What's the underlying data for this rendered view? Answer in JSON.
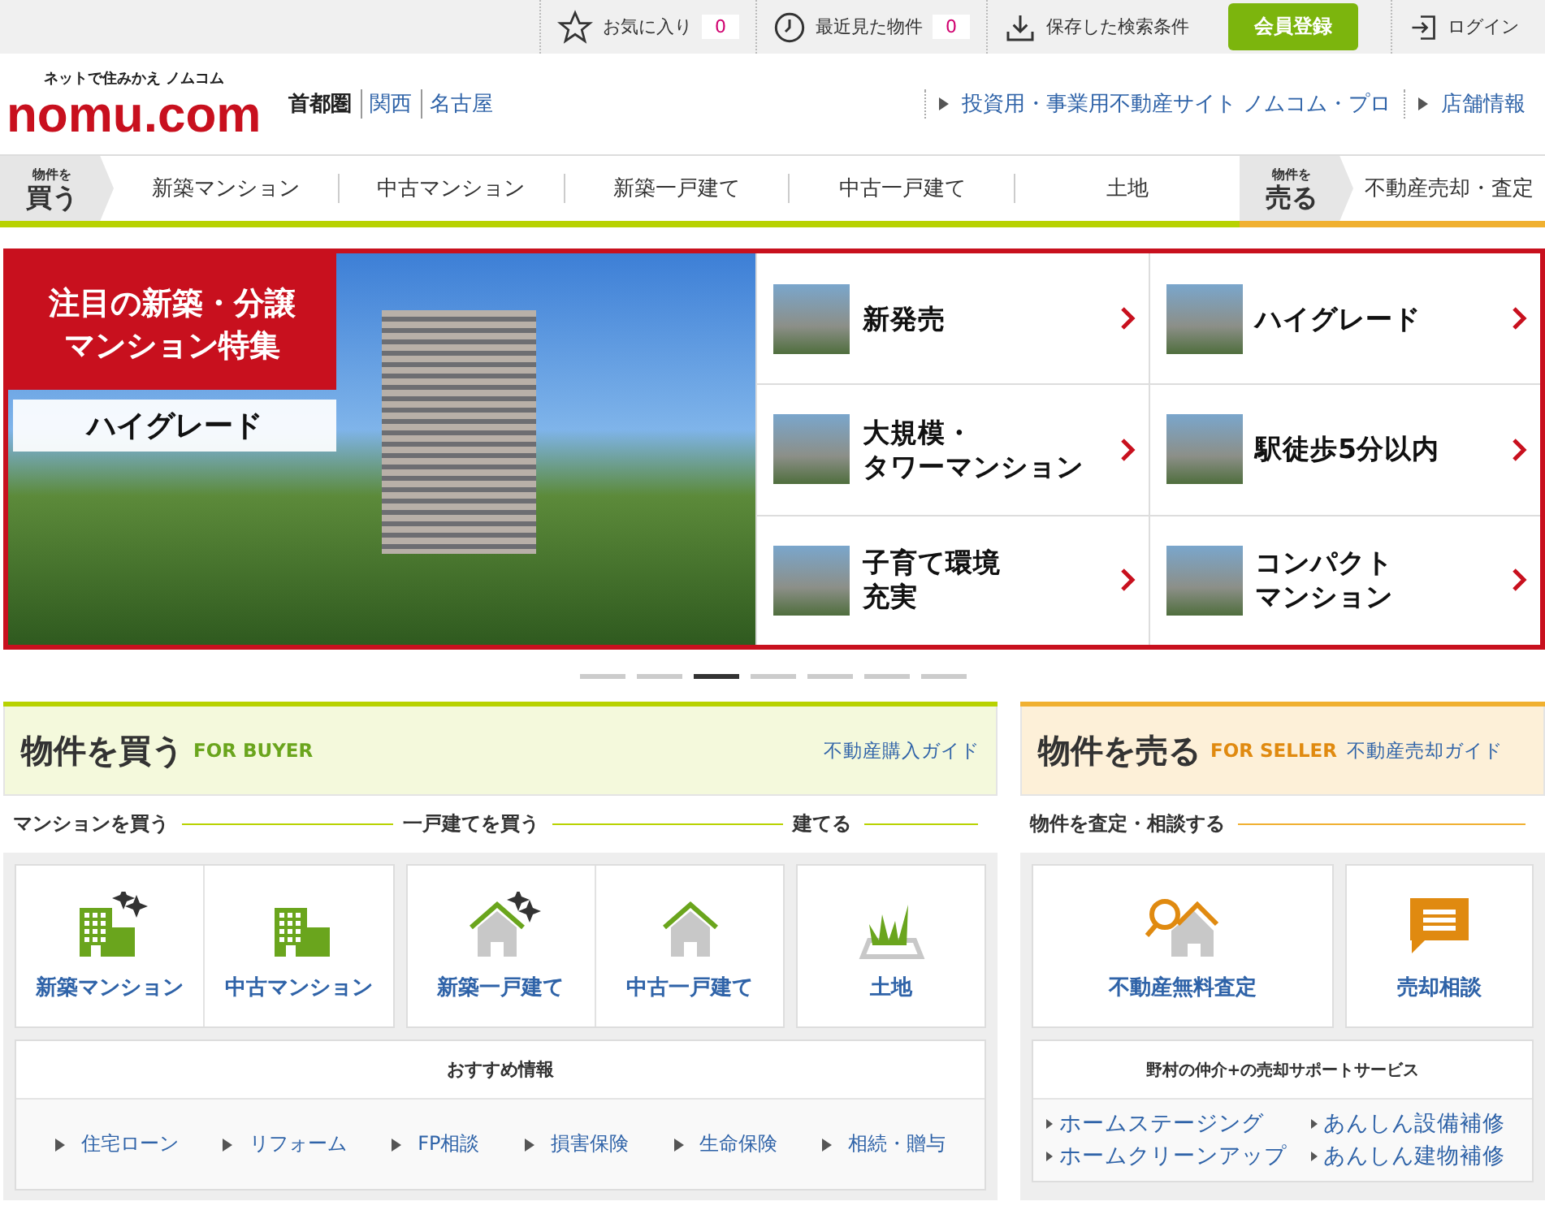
{
  "top_bar": {
    "favorites": {
      "label": "お気に入り",
      "count": "0"
    },
    "recent": {
      "label": "最近見た物件",
      "count": "0"
    },
    "saved_search": {
      "label": "保存した検索条件"
    },
    "register": "会員登録",
    "login": "ログイン"
  },
  "header": {
    "tagline": "ネットで住みかえ ノムコム",
    "logo": "nomu.com",
    "regions": [
      {
        "label": "首都圏",
        "selected": true
      },
      {
        "label": "関西",
        "selected": false
      },
      {
        "label": "名古屋",
        "selected": false
      }
    ],
    "links": [
      "投資用・事業用不動産サイト ノムコム・プロ",
      "店舗情報"
    ]
  },
  "nav": {
    "buy_tag": {
      "small": "物件を",
      "big": "買う"
    },
    "buy_items": [
      "新築マンション",
      "中古マンション",
      "新築一戸建て",
      "中古一戸建て",
      "土地"
    ],
    "sell_tag": {
      "small": "物件を",
      "big": "売る"
    },
    "sell_item": "不動産売却・査定"
  },
  "banner": {
    "title": [
      "注目の新築・分譲",
      "マンション特集"
    ],
    "subtitle": "ハイグレード",
    "tiles": [
      {
        "lines": [
          "新発売"
        ]
      },
      {
        "lines": [
          "ハイグレード"
        ]
      },
      {
        "lines": [
          "大規模・",
          "タワーマンション"
        ]
      },
      {
        "lines": [
          "駅徒歩5分以内"
        ]
      },
      {
        "lines": [
          "子育て環境",
          "充実"
        ]
      },
      {
        "lines": [
          "コンパクト",
          "マンション"
        ]
      }
    ]
  },
  "pager": [
    {
      "selected": false
    },
    {
      "selected": false
    },
    {
      "selected": true
    },
    {
      "selected": false
    },
    {
      "selected": false
    },
    {
      "selected": false
    },
    {
      "selected": false
    }
  ],
  "buyer": {
    "title": "物件を買う",
    "subtitle": "FOR BUYER",
    "guide": "不動産購入ガイド",
    "groups": [
      {
        "label": "マンションを買う",
        "items": [
          {
            "label": "新築マンション",
            "kind": "new-building"
          },
          {
            "label": "中古マンション",
            "kind": "building"
          }
        ]
      },
      {
        "label": "一戸建てを買う",
        "items": [
          {
            "label": "新築一戸建て",
            "kind": "new-house"
          },
          {
            "label": "中古一戸建て",
            "kind": "house"
          }
        ]
      },
      {
        "label": "建てる",
        "items": [
          {
            "label": "土地",
            "kind": "land"
          }
        ]
      }
    ],
    "recommend": {
      "title": "おすすめ情報",
      "links": [
        "住宅ローン",
        "リフォーム",
        "FP相談",
        "損害保険",
        "生命保険",
        "相続・贈与"
      ]
    }
  },
  "seller": {
    "title": "物件を売る",
    "subtitle": "FOR SELLER",
    "guide": "不動産売却ガイド",
    "section": "物件を査定・相談する",
    "items": [
      {
        "label": "不動産無料査定",
        "kind": "appraisal"
      },
      {
        "label": "売却相談",
        "kind": "chat"
      }
    ],
    "support": {
      "title": "野村の仲介+の売却サポートサービス",
      "links": [
        "ホームステージング",
        "あんしん設備補修",
        "ホームクリーンアップ",
        "あんしん建物補修"
      ]
    }
  }
}
